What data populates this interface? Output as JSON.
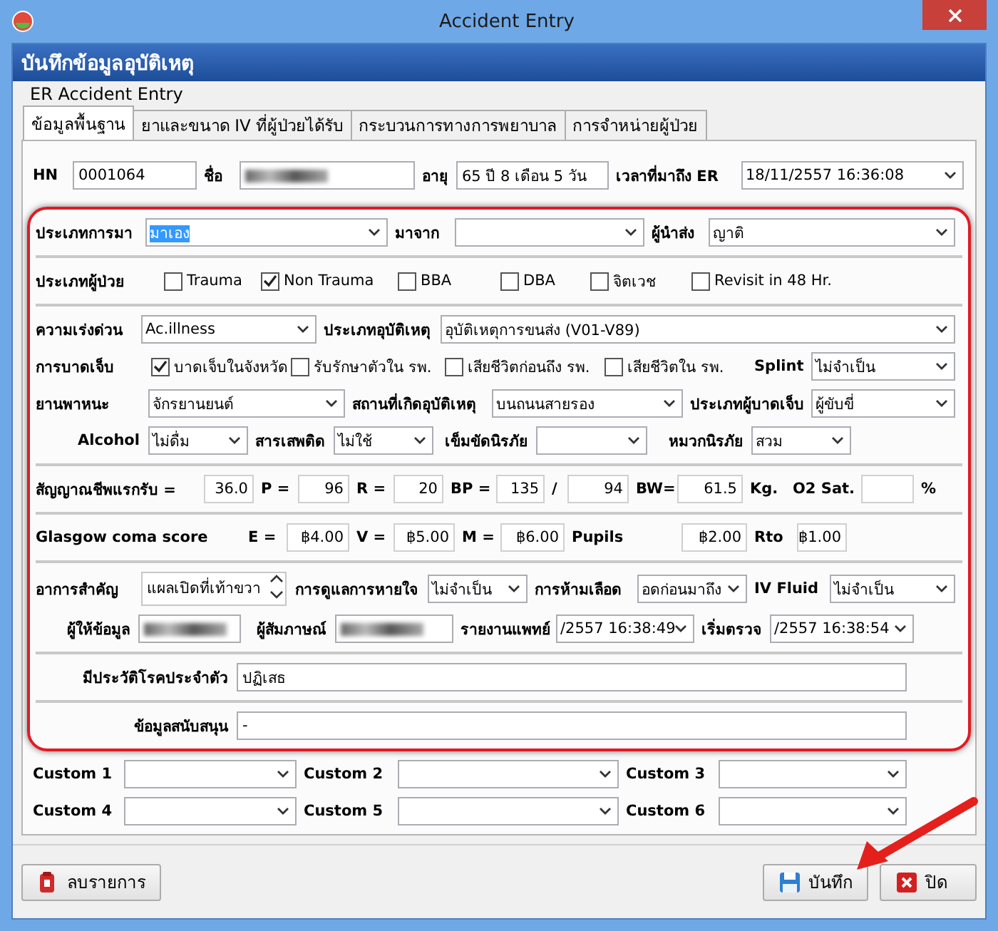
{
  "window": {
    "title": "Accident Entry"
  },
  "header": {
    "title": "บันทึกข้อมูลอุบัติเหตุ",
    "subtitle": "ER Accident Entry"
  },
  "tabs": [
    {
      "label": "ข้อมูลพื้นฐาน",
      "selected": true
    },
    {
      "label": "ยาและขนาด IV ที่ผู้ป่วยได้รับ",
      "selected": false
    },
    {
      "label": "กระบวนการทางการพยาบาล",
      "selected": false
    },
    {
      "label": "การจำหน่ายผู้ป่วย",
      "selected": false
    }
  ],
  "patient": [
    {
      "kind": "label",
      "text": "HN"
    },
    {
      "kind": "text",
      "value": "0001064"
    },
    {
      "kind": "label",
      "text": "ชื่อ"
    },
    {
      "kind": "text",
      "redacted": true
    },
    {
      "kind": "label",
      "text": "อายุ"
    },
    {
      "kind": "text",
      "value": "65 ปี 8 เดือน 5 วัน"
    },
    {
      "kind": "label",
      "text": "เวลาที่มาถึง ER"
    },
    {
      "kind": "combo",
      "value": "18/11/2557 16:36:08"
    }
  ],
  "sections": [
    {
      "rows": [
        {
          "items": [
            {
              "kind": "label",
              "text": "ประเภทการมา"
            },
            {
              "kind": "combo",
              "value": "มาเอง",
              "highlighted": true
            },
            {
              "kind": "label",
              "text": "มาจาก"
            },
            {
              "kind": "combo"
            },
            {
              "kind": "label",
              "text": "ผู้นำส่ง"
            },
            {
              "kind": "combo",
              "value": "ญาติ"
            }
          ]
        }
      ]
    },
    {
      "rows": [
        {
          "items": [
            {
              "kind": "label",
              "text": "ประเภทผู้ป่วย"
            },
            {
              "kind": "check",
              "label": "Trauma",
              "checked": false
            },
            {
              "kind": "check",
              "label": "Non Trauma",
              "checked": true
            },
            {
              "kind": "check",
              "label": "BBA",
              "checked": false
            },
            {
              "kind": "check",
              "label": "DBA",
              "checked": false
            },
            {
              "kind": "check",
              "label": "จิตเวช",
              "checked": false
            },
            {
              "kind": "check",
              "label": "Revisit in 48 Hr.",
              "checked": false
            }
          ]
        }
      ]
    },
    {
      "rows": [
        {
          "items": [
            {
              "kind": "label",
              "text": "ความเร่งด่วน"
            },
            {
              "kind": "combo",
              "value": "Ac.illness"
            },
            {
              "kind": "label",
              "text": "ประเภทอุบัติเหตุ"
            },
            {
              "kind": "combo",
              "value": "อุบัติเหตุการขนส่ง (V01-V89)"
            }
          ]
        },
        {
          "items": [
            {
              "kind": "label",
              "text": "การบาดเจ็บ"
            },
            {
              "kind": "check",
              "label": "บาดเจ็บในจังหวัด",
              "checked": true
            },
            {
              "kind": "check",
              "label": "รับรักษาตัวใน รพ.",
              "checked": false
            },
            {
              "kind": "check",
              "label": "เสียชีวิตก่อนถึง รพ.",
              "checked": false
            },
            {
              "kind": "check",
              "label": "เสียชีวิตใน รพ.",
              "checked": false
            },
            {
              "kind": "label",
              "text": "Splint"
            },
            {
              "kind": "combo",
              "value": "ไม่จำเป็น"
            }
          ]
        },
        {
          "items": [
            {
              "kind": "label",
              "text": "ยานพาหนะ"
            },
            {
              "kind": "combo",
              "value": "จักรยานยนต์"
            },
            {
              "kind": "label",
              "text": "สถานที่เกิดอุบัติเหตุ"
            },
            {
              "kind": "combo",
              "value": "บนถนนสายรอง"
            },
            {
              "kind": "label",
              "text": "ประเภทผู้บาดเจ็บ"
            },
            {
              "kind": "combo",
              "value": "ผู้ขับขี่"
            }
          ]
        },
        {
          "items": [
            {
              "kind": "label",
              "text": "Alcohol"
            },
            {
              "kind": "combo",
              "value": "ไม่ดื่ม"
            },
            {
              "kind": "label",
              "text": "สารเสพติด"
            },
            {
              "kind": "combo",
              "value": "ไม่ใช้"
            },
            {
              "kind": "label",
              "text": "เข็มขัดนิรภัย"
            },
            {
              "kind": "combo"
            },
            {
              "kind": "label",
              "text": "หมวกนิรภัย"
            },
            {
              "kind": "combo",
              "value": "สวม"
            }
          ]
        }
      ]
    },
    {
      "rows": [
        {
          "items": [
            {
              "kind": "label",
              "text": "สัญญาณชีพแรกรับ ="
            },
            {
              "kind": "text",
              "value": "36.0"
            },
            {
              "kind": "label",
              "text": "P ="
            },
            {
              "kind": "text",
              "value": "96"
            },
            {
              "kind": "label",
              "text": "R ="
            },
            {
              "kind": "text",
              "value": "20"
            },
            {
              "kind": "label",
              "text": "BP ="
            },
            {
              "kind": "text",
              "value": "135"
            },
            {
              "kind": "label",
              "text": "/"
            },
            {
              "kind": "text",
              "value": "94"
            },
            {
              "kind": "label",
              "text": "BW="
            },
            {
              "kind": "text",
              "value": "61.5"
            },
            {
              "kind": "label",
              "text": "Kg."
            },
            {
              "kind": "label",
              "text": "O2 Sat."
            },
            {
              "kind": "text"
            },
            {
              "kind": "label",
              "text": "%"
            }
          ]
        }
      ]
    },
    {
      "rows": [
        {
          "items": [
            {
              "kind": "label",
              "text": "Glasgow coma score"
            },
            {
              "kind": "label",
              "text": "E ="
            },
            {
              "kind": "text",
              "value": "฿4.00"
            },
            {
              "kind": "label",
              "text": "V ="
            },
            {
              "kind": "text",
              "value": "฿5.00"
            },
            {
              "kind": "label",
              "text": "M ="
            },
            {
              "kind": "text",
              "value": "฿6.00"
            },
            {
              "kind": "label",
              "text": "Pupils"
            },
            {
              "kind": "text",
              "value": "฿2.00"
            },
            {
              "kind": "label",
              "text": "Rto"
            },
            {
              "kind": "text",
              "value": "฿1.00"
            }
          ]
        }
      ]
    },
    {
      "rows": [
        {
          "items": [
            {
              "kind": "label",
              "text": "อาการสำคัญ"
            },
            {
              "kind": "memo",
              "value": "แผลเปิดที่เท้าขวา"
            },
            {
              "kind": "label",
              "text": "การดูแลการหายใจ"
            },
            {
              "kind": "combo",
              "value": "ไม่จำเป็น"
            },
            {
              "kind": "label",
              "text": "การห้ามเลือด"
            },
            {
              "kind": "combo",
              "value": "อดก่อนมาถึง"
            },
            {
              "kind": "label",
              "text": "IV Fluid"
            },
            {
              "kind": "combo",
              "value": "ไม่จำเป็น"
            }
          ]
        },
        {
          "items": [
            {
              "kind": "label",
              "text": "ผู้ให้ข้อมูล"
            },
            {
              "kind": "text",
              "redacted": true
            },
            {
              "kind": "label",
              "text": "ผู้สัมภาษณ์"
            },
            {
              "kind": "text",
              "redacted": true
            },
            {
              "kind": "label",
              "text": "รายงานแพทย์"
            },
            {
              "kind": "combo",
              "value": "/2557 16:38:49"
            },
            {
              "kind": "label",
              "text": "เริ่มตรวจ"
            },
            {
              "kind": "combo",
              "value": "/2557 16:38:54"
            }
          ]
        }
      ]
    },
    {
      "rows": [
        {
          "items": [
            {
              "kind": "label",
              "text": "มีประวัติโรคประจำตัว"
            },
            {
              "kind": "text",
              "value": "ปฏิเสธ"
            }
          ]
        }
      ]
    },
    {
      "rows": [
        {
          "items": [
            {
              "kind": "label",
              "text": "ข้อมูลสนับสนุน"
            },
            {
              "kind": "text",
              "value": "-"
            }
          ]
        }
      ]
    }
  ],
  "custom_fields": [
    {
      "label": "Custom 1"
    },
    {
      "label": "Custom 2"
    },
    {
      "label": "Custom 3"
    },
    {
      "label": "Custom 4"
    },
    {
      "label": "Custom 5"
    },
    {
      "label": "Custom 6"
    }
  ],
  "buttons": [
    {
      "kind": "delete",
      "label": "ลบรายการ"
    },
    {
      "kind": "save",
      "label": "บันทึก"
    },
    {
      "kind": "close",
      "label": "ปิด"
    }
  ]
}
